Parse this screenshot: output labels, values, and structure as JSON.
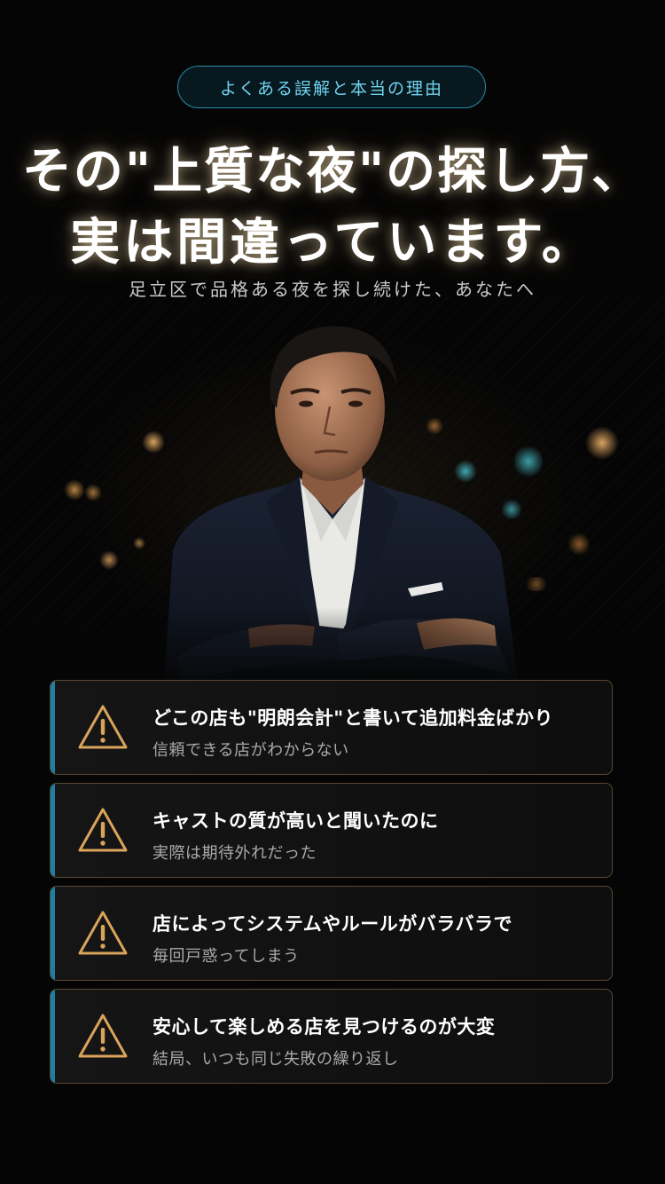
{
  "header": {
    "tag": "よくある誤解と本当の理由",
    "headline_line1": "その\"上質な夜\"の探し方、",
    "headline_line2": "実は間違っています。",
    "subheadline": "足立区で品格ある夜を探し続けた、あなたへ"
  },
  "colors": {
    "accent": "#1f7fa3",
    "tag_border": "#2c8aa6",
    "warning_icon": "#d9a45a",
    "card_border": "#5a4a33"
  },
  "problems": [
    {
      "icon": "warning-icon",
      "title": "どこの店も\"明朗会計\"と書いて追加料金ばかり",
      "detail": "信頼できる店がわからない"
    },
    {
      "icon": "warning-icon",
      "title": "キャストの質が高いと聞いたのに",
      "detail": "実際は期待外れだった"
    },
    {
      "icon": "warning-icon",
      "title": "店によってシステムやルールがバラバラで",
      "detail": "毎回戸惑ってしまう"
    },
    {
      "icon": "warning-icon",
      "title": "安心して楽しめる店を見つけるのが大変",
      "detail": "結局、いつも同じ失敗の繰り返し"
    }
  ]
}
